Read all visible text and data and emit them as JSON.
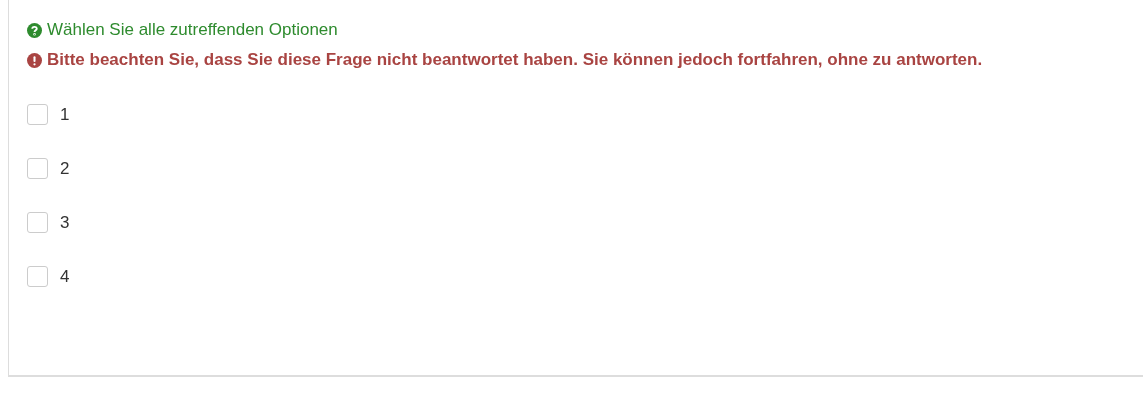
{
  "hint": {
    "text": "Wählen Sie alle zutreffenden Optionen"
  },
  "warning": {
    "text": "Bitte beachten Sie, dass Sie diese Frage nicht beantwortet haben. Sie können jedoch fortfahren, ohne zu antworten."
  },
  "options": [
    {
      "label": "1",
      "checked": false
    },
    {
      "label": "2",
      "checked": false
    },
    {
      "label": "3",
      "checked": false
    },
    {
      "label": "4",
      "checked": false
    }
  ]
}
